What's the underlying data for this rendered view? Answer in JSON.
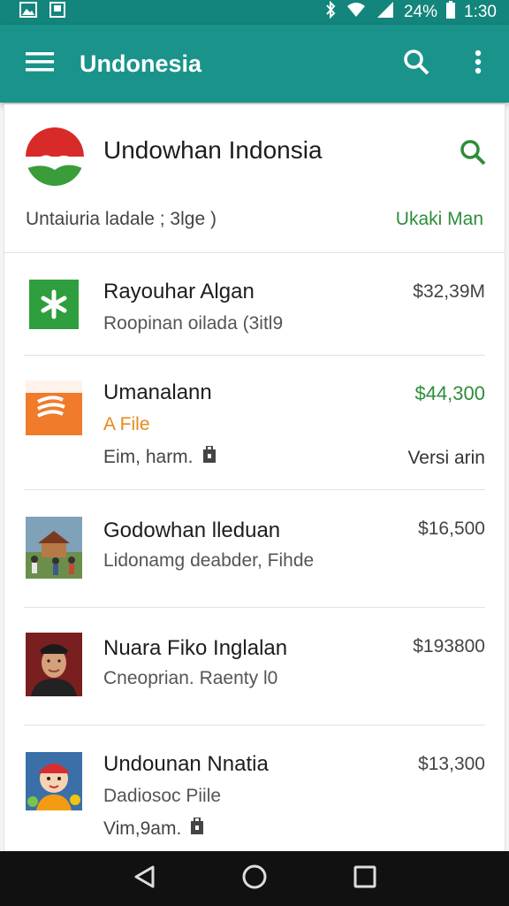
{
  "status_bar": {
    "battery": "24%",
    "time": "1:30"
  },
  "app_bar": {
    "title": "Undonesia"
  },
  "header": {
    "title": "Undowhan Indonsia",
    "subtitle": "Untaiuria ladale ; 3lge )",
    "link": "Ukaki Man"
  },
  "items": [
    {
      "title": "Rayouhar Algan",
      "subtitle": "Roopinan oilada (3itl9",
      "price": "$32,39M",
      "thumb_icon": "asterisk-icon",
      "thumb_color": "#2e9e3e"
    },
    {
      "title": "Umanalann",
      "file_label": "A File",
      "meta": "Eim, harm.",
      "version": "Versi arin",
      "price": "$44,300",
      "thumb_icon": "flag-icon",
      "thumb_color": "#f07b2a"
    },
    {
      "title": "Godowhan lleduan",
      "subtitle": "Lidonamg deabder, Fihde",
      "price": "$16,500",
      "thumb_icon": "village-photo"
    },
    {
      "title": "Nuara Fiko Inglalan",
      "subtitle": "Cneoprian. Raenty l0",
      "price": "$193800",
      "thumb_icon": "person-photo"
    },
    {
      "title": "Undounan Nnatia",
      "subtitle": "Dadiosoc Piile",
      "meta": "Vim,9am.",
      "price": "$13,300",
      "thumb_icon": "cartoon-avatar"
    }
  ],
  "colors": {
    "app_bar": "#1a948a",
    "status_bar": "#13857c",
    "accent_green": "#2e8d3a",
    "accent_orange": "#e68a1a"
  }
}
